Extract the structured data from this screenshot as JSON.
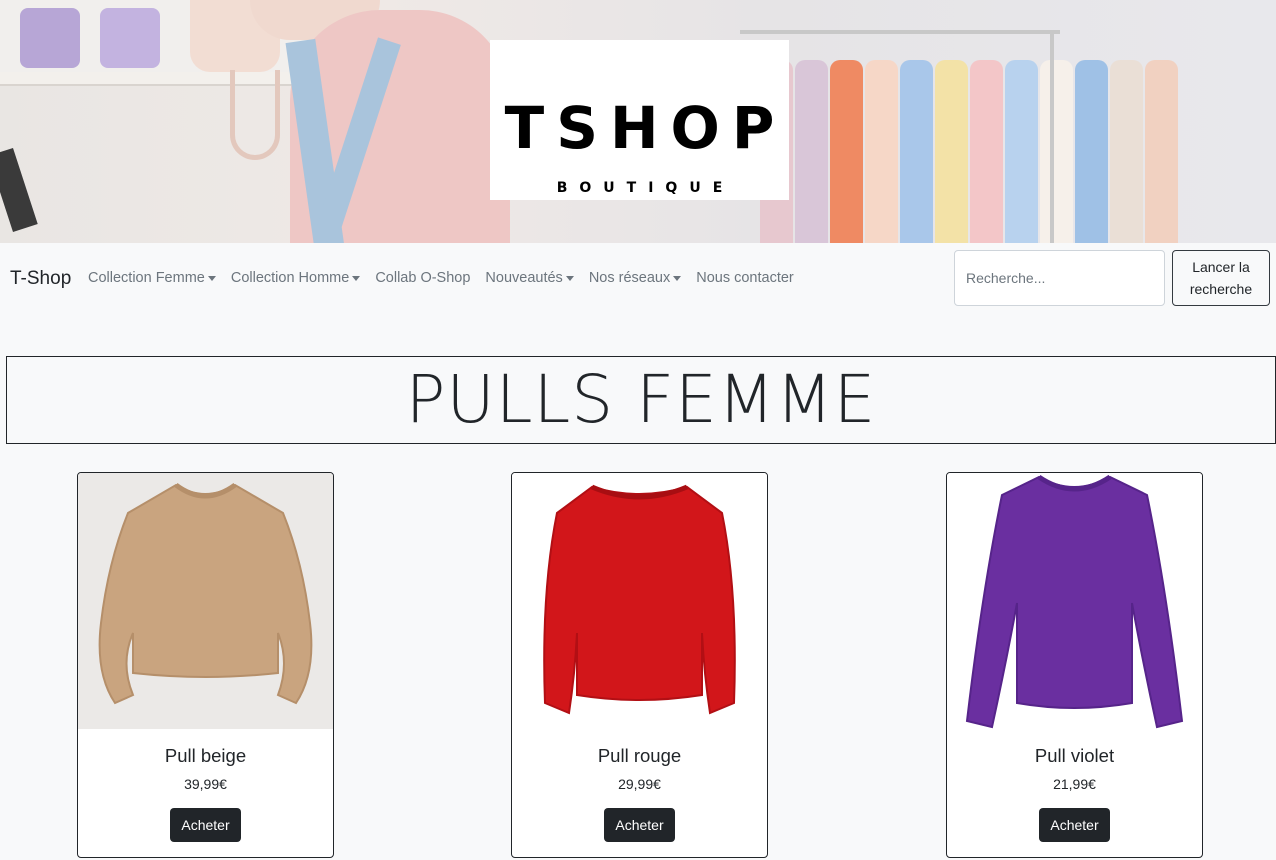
{
  "hero": {
    "logo_main": "TSHOP",
    "logo_sub": "BOUTIQUE"
  },
  "navbar": {
    "brand": "T-Shop",
    "items": [
      {
        "label": "Collection Femme",
        "dropdown": true
      },
      {
        "label": "Collection Homme",
        "dropdown": true
      },
      {
        "label": "Collab O-Shop",
        "dropdown": false
      },
      {
        "label": "Nouveautés",
        "dropdown": true
      },
      {
        "label": "Nos réseaux",
        "dropdown": true
      },
      {
        "label": "Nous contacter",
        "dropdown": false
      }
    ],
    "search_placeholder": "Recherche...",
    "search_button": "Lancer la recherche"
  },
  "page": {
    "title": "PULLS FEMME"
  },
  "products": [
    {
      "name": "Pull beige",
      "price": "39,99€",
      "button": "Acheter",
      "color": "#c9a47f",
      "bg": "#ebe9e7"
    },
    {
      "name": "Pull rouge",
      "price": "29,99€",
      "button": "Acheter",
      "color": "#d2161a",
      "bg": "#ffffff"
    },
    {
      "name": "Pull violet",
      "price": "21,99€",
      "button": "Acheter",
      "color": "#6a2fa0",
      "bg": "#ffffff"
    }
  ],
  "colors": {
    "accent_dark": "#212529",
    "nav_text": "#6c757d",
    "page_bg": "#f8f9fa"
  }
}
